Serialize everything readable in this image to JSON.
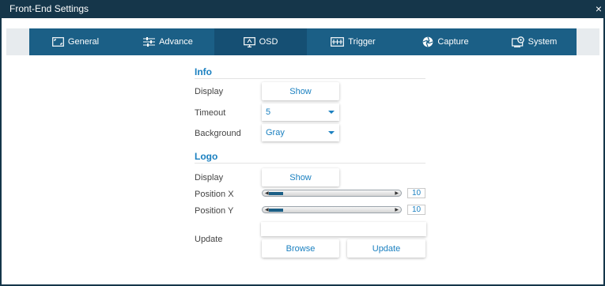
{
  "window": {
    "title": "Front-End Settings",
    "close_glyph": "×"
  },
  "tabs": [
    {
      "label": "General",
      "icon": "screen-icon"
    },
    {
      "label": "Advance",
      "icon": "sliders-icon"
    },
    {
      "label": "OSD",
      "icon": "osd-monitor-icon"
    },
    {
      "label": "Trigger",
      "icon": "trigger-board-icon"
    },
    {
      "label": "Capture",
      "icon": "camera-aperture-icon"
    },
    {
      "label": "System",
      "icon": "system-gear-icon"
    }
  ],
  "active_tab": "OSD",
  "info": {
    "title": "Info",
    "display_label": "Display",
    "display_button": "Show",
    "timeout_label": "Timeout",
    "timeout_value": "5",
    "background_label": "Background",
    "background_value": "Gray"
  },
  "logo": {
    "title": "Logo",
    "display_label": "Display",
    "display_button": "Show",
    "position_x_label": "Position X",
    "position_x_value": "10",
    "position_y_label": "Position Y",
    "position_y_value": "10",
    "update_label": "Update",
    "file_value": "",
    "browse_button": "Browse",
    "update_button": "Update"
  },
  "colors": {
    "titlebar": "#15364a",
    "tabbar": "#1b5f86",
    "tab_active": "#154f73",
    "accent_text": "#1b80c0"
  }
}
